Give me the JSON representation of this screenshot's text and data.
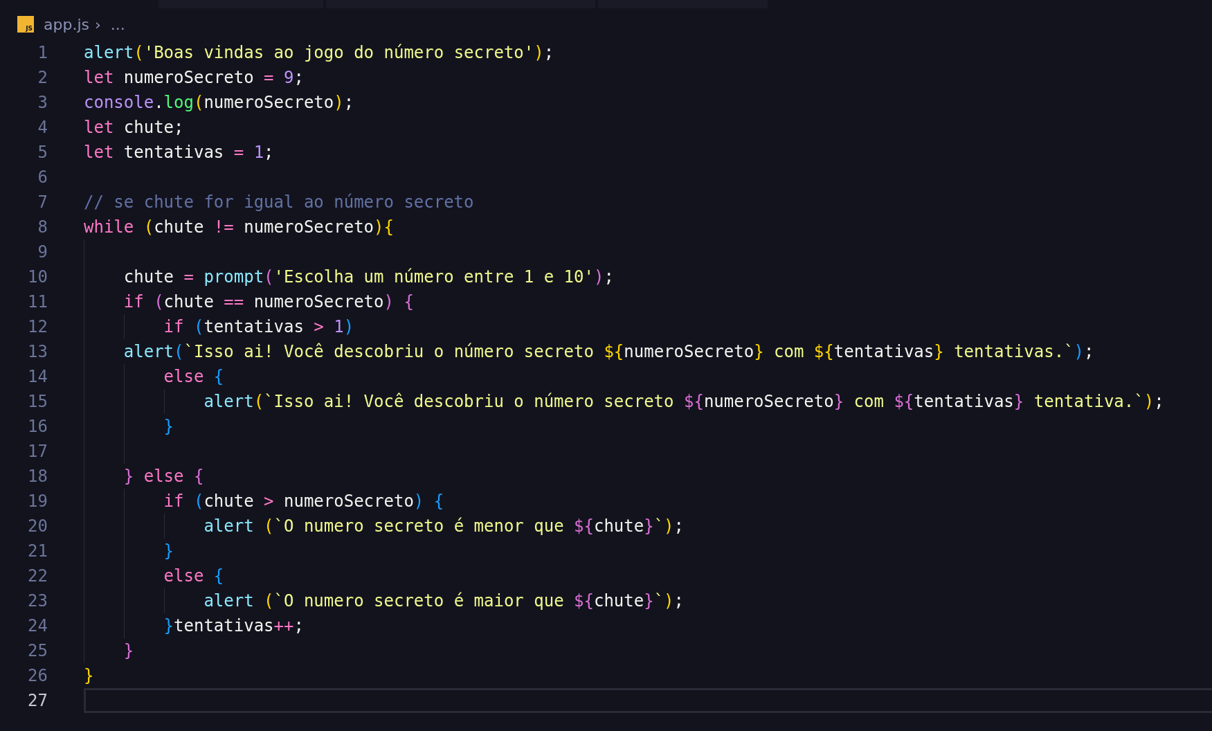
{
  "breadcrumb": {
    "file_icon_label": "JS",
    "file": "app.js",
    "separator": "›",
    "more": "..."
  },
  "lines": [
    {
      "number": "1",
      "active": false,
      "tokens": [
        {
          "text": "alert",
          "kind": "fn"
        },
        {
          "text": "(",
          "kind": "b1"
        },
        {
          "text": "'Boas vindas ao jogo do número secreto'",
          "kind": "str"
        },
        {
          "text": ")",
          "kind": "b1"
        },
        {
          "text": ";",
          "kind": "text"
        }
      ]
    },
    {
      "number": "2",
      "active": false,
      "tokens": [
        {
          "text": "let",
          "kind": "kw"
        },
        {
          "text": " numeroSecreto ",
          "kind": "text"
        },
        {
          "text": "=",
          "kind": "op"
        },
        {
          "text": " 9",
          "kind": "num"
        },
        {
          "text": ";",
          "kind": "text"
        }
      ]
    },
    {
      "number": "3",
      "active": false,
      "tokens": [
        {
          "text": "console",
          "kind": "obj"
        },
        {
          "text": ".",
          "kind": "text"
        },
        {
          "text": "log",
          "kind": "method"
        },
        {
          "text": "(",
          "kind": "b1"
        },
        {
          "text": "numeroSecreto",
          "kind": "text"
        },
        {
          "text": ")",
          "kind": "b1"
        },
        {
          "text": ";",
          "kind": "text"
        }
      ]
    },
    {
      "number": "4",
      "active": false,
      "tokens": [
        {
          "text": "let",
          "kind": "kw"
        },
        {
          "text": " chute;",
          "kind": "text"
        }
      ]
    },
    {
      "number": "5",
      "active": false,
      "tokens": [
        {
          "text": "let",
          "kind": "kw"
        },
        {
          "text": " tentativas ",
          "kind": "text"
        },
        {
          "text": "=",
          "kind": "op"
        },
        {
          "text": " 1",
          "kind": "num"
        },
        {
          "text": ";",
          "kind": "text"
        }
      ]
    },
    {
      "number": "6",
      "active": false
    },
    {
      "number": "7",
      "active": false,
      "tokens": [
        {
          "text": "// se chute for igual ao número secreto",
          "kind": "comment"
        }
      ]
    },
    {
      "number": "8",
      "active": false,
      "tokens": [
        {
          "text": "while",
          "kind": "kw"
        },
        {
          "text": " (",
          "kind": "b1"
        },
        {
          "text": "chute ",
          "kind": "text"
        },
        {
          "text": "!=",
          "kind": "op"
        },
        {
          "text": " numeroSecreto",
          "kind": "text"
        },
        {
          "text": "){",
          "kind": "b1"
        }
      ]
    },
    {
      "number": "9",
      "active": false
    },
    {
      "number": "10",
      "active": false,
      "tokens": [
        {
          "text": "    chute ",
          "kind": "text"
        },
        {
          "text": "=",
          "kind": "op"
        },
        {
          "text": " prompt",
          "kind": "fn"
        },
        {
          "text": "(",
          "kind": "b2"
        },
        {
          "text": "'Escolha um número entre 1 e 10'",
          "kind": "str"
        },
        {
          "text": ")",
          "kind": "b2"
        },
        {
          "text": ";",
          "kind": "text"
        }
      ]
    },
    {
      "number": "11",
      "active": false,
      "tokens": [
        {
          "text": "    if",
          "kind": "kw"
        },
        {
          "text": " (",
          "kind": "b2"
        },
        {
          "text": "chute ",
          "kind": "text"
        },
        {
          "text": "==",
          "kind": "op"
        },
        {
          "text": " numeroSecreto",
          "kind": "text"
        },
        {
          "text": ") {",
          "kind": "b2"
        }
      ]
    },
    {
      "number": "12",
      "active": false,
      "tokens": [
        {
          "text": "        if",
          "kind": "kw"
        },
        {
          "text": " (",
          "kind": "b3"
        },
        {
          "text": "tentativas ",
          "kind": "text"
        },
        {
          "text": ">",
          "kind": "op"
        },
        {
          "text": " 1",
          "kind": "num"
        },
        {
          "text": ")",
          "kind": "b3"
        }
      ]
    },
    {
      "number": "13",
      "active": false,
      "tokens": [
        {
          "text": "    alert",
          "kind": "fn"
        },
        {
          "text": "(",
          "kind": "b3"
        },
        {
          "text": "`Isso ai! Você descobriu o número secreto ",
          "kind": "str"
        },
        {
          "text": "${",
          "kind": "b1"
        },
        {
          "text": "numeroSecreto",
          "kind": "text"
        },
        {
          "text": "}",
          "kind": "b1"
        },
        {
          "text": " com ",
          "kind": "str"
        },
        {
          "text": "${",
          "kind": "b1"
        },
        {
          "text": "tentativas",
          "kind": "text"
        },
        {
          "text": "}",
          "kind": "b1"
        },
        {
          "text": " tentativas.`",
          "kind": "str"
        },
        {
          "text": ")",
          "kind": "b3"
        },
        {
          "text": ";",
          "kind": "text"
        }
      ]
    },
    {
      "number": "14",
      "active": false,
      "tokens": [
        {
          "text": "        else",
          "kind": "kw"
        },
        {
          "text": " {",
          "kind": "b3"
        }
      ]
    },
    {
      "number": "15",
      "active": false,
      "tokens": [
        {
          "text": "            alert",
          "kind": "fn"
        },
        {
          "text": "(",
          "kind": "b1"
        },
        {
          "text": "`Isso ai! Você descobriu o número secreto ",
          "kind": "str"
        },
        {
          "text": "${",
          "kind": "b2"
        },
        {
          "text": "numeroSecreto",
          "kind": "text"
        },
        {
          "text": "}",
          "kind": "b2"
        },
        {
          "text": " com ",
          "kind": "str"
        },
        {
          "text": "${",
          "kind": "b2"
        },
        {
          "text": "tentativas",
          "kind": "text"
        },
        {
          "text": "}",
          "kind": "b2"
        },
        {
          "text": " tentativa.`",
          "kind": "str"
        },
        {
          "text": ")",
          "kind": "b1"
        },
        {
          "text": ";",
          "kind": "text"
        }
      ]
    },
    {
      "number": "16",
      "active": false,
      "tokens": [
        {
          "text": "        }",
          "kind": "b3"
        }
      ]
    },
    {
      "number": "17",
      "active": false
    },
    {
      "number": "18",
      "active": false,
      "tokens": [
        {
          "text": "    }",
          "kind": "b2"
        },
        {
          "text": " else",
          "kind": "kw"
        },
        {
          "text": " {",
          "kind": "b2"
        }
      ]
    },
    {
      "number": "19",
      "active": false,
      "tokens": [
        {
          "text": "        if",
          "kind": "kw"
        },
        {
          "text": " (",
          "kind": "b3"
        },
        {
          "text": "chute ",
          "kind": "text"
        },
        {
          "text": ">",
          "kind": "op"
        },
        {
          "text": " numeroSecreto",
          "kind": "text"
        },
        {
          "text": ") {",
          "kind": "b3"
        }
      ]
    },
    {
      "number": "20",
      "active": false,
      "tokens": [
        {
          "text": "            alert",
          "kind": "fn"
        },
        {
          "text": " (",
          "kind": "b1"
        },
        {
          "text": "`O numero secreto é menor que ",
          "kind": "str"
        },
        {
          "text": "${",
          "kind": "b2"
        },
        {
          "text": "chute",
          "kind": "text"
        },
        {
          "text": "}",
          "kind": "b2"
        },
        {
          "text": "`",
          "kind": "str"
        },
        {
          "text": ")",
          "kind": "b1"
        },
        {
          "text": ";",
          "kind": "text"
        }
      ]
    },
    {
      "number": "21",
      "active": false,
      "tokens": [
        {
          "text": "        }",
          "kind": "b3"
        }
      ]
    },
    {
      "number": "22",
      "active": false,
      "tokens": [
        {
          "text": "        else",
          "kind": "kw"
        },
        {
          "text": " {",
          "kind": "b3"
        }
      ]
    },
    {
      "number": "23",
      "active": false,
      "tokens": [
        {
          "text": "            alert",
          "kind": "fn"
        },
        {
          "text": " (",
          "kind": "b1"
        },
        {
          "text": "`O numero secreto é maior que ",
          "kind": "str"
        },
        {
          "text": "${",
          "kind": "b2"
        },
        {
          "text": "chute",
          "kind": "text"
        },
        {
          "text": "}",
          "kind": "b2"
        },
        {
          "text": "`",
          "kind": "str"
        },
        {
          "text": ")",
          "kind": "b1"
        },
        {
          "text": ";",
          "kind": "text"
        }
      ]
    },
    {
      "number": "24",
      "active": false,
      "tokens": [
        {
          "text": "        }",
          "kind": "b3"
        },
        {
          "text": "tentativas",
          "kind": "text"
        },
        {
          "text": "++",
          "kind": "op"
        },
        {
          "text": ";",
          "kind": "text"
        }
      ]
    },
    {
      "number": "25",
      "active": false,
      "tokens": [
        {
          "text": "    }",
          "kind": "b2"
        }
      ]
    },
    {
      "number": "26",
      "active": false,
      "tokens": [
        {
          "text": "}",
          "kind": "b1"
        }
      ]
    },
    {
      "number": "27",
      "active": true
    }
  ]
}
